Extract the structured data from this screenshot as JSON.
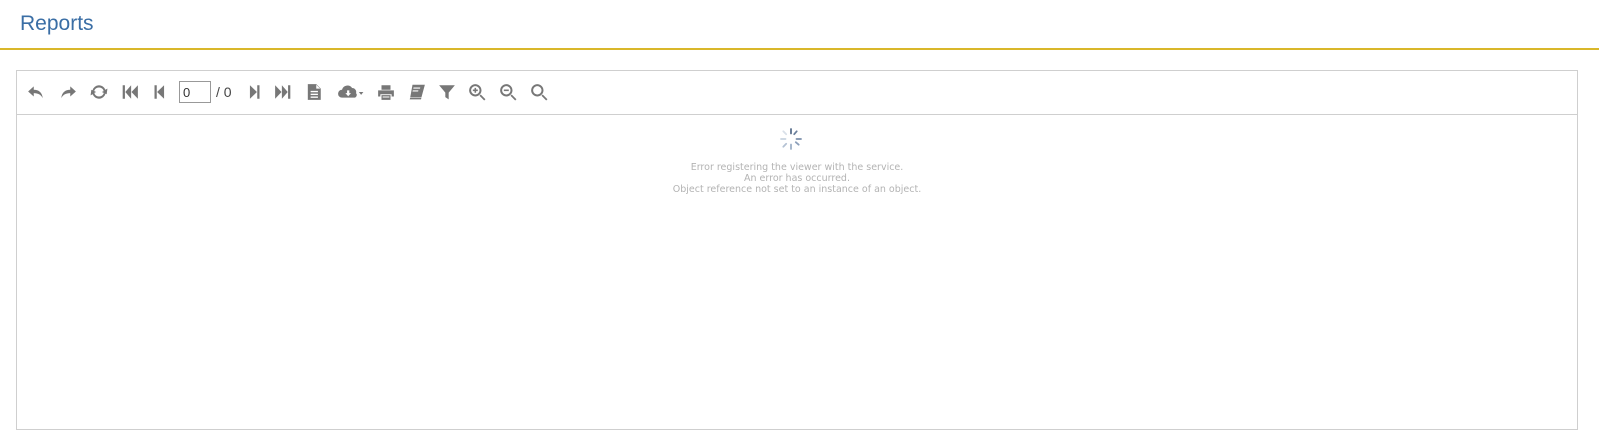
{
  "header": {
    "title": "Reports"
  },
  "toolbar": {
    "buttons": [
      {
        "name": "undo-button",
        "icon": "undo-icon"
      },
      {
        "name": "redo-button",
        "icon": "redo-icon"
      },
      {
        "name": "refresh-button",
        "icon": "refresh-icon"
      },
      {
        "name": "first-page-button",
        "icon": "first-page-icon"
      },
      {
        "name": "previous-page-button",
        "icon": "previous-page-icon"
      },
      {
        "name": "next-page-button",
        "icon": "next-page-icon"
      },
      {
        "name": "last-page-button",
        "icon": "last-page-icon"
      },
      {
        "name": "document-button",
        "icon": "document-icon"
      },
      {
        "name": "export-button",
        "icon": "cloud-download-icon"
      },
      {
        "name": "print-button",
        "icon": "print-icon"
      },
      {
        "name": "print-layout-button",
        "icon": "book-icon"
      },
      {
        "name": "parameters-button",
        "icon": "filter-icon"
      },
      {
        "name": "zoom-in-button",
        "icon": "zoom-in-icon"
      },
      {
        "name": "zoom-out-button",
        "icon": "zoom-out-icon"
      },
      {
        "name": "search-button",
        "icon": "search-icon"
      }
    ],
    "page_current": "0",
    "page_total": "/ 0"
  },
  "viewer": {
    "error_lines": [
      "Error registering the viewer with the service.",
      "An error has occurred.",
      "Object reference not set to an instance of an object."
    ]
  },
  "colors": {
    "accent_border": "#d9b72a",
    "title": "#3a6ea5",
    "icon": "#777777"
  }
}
